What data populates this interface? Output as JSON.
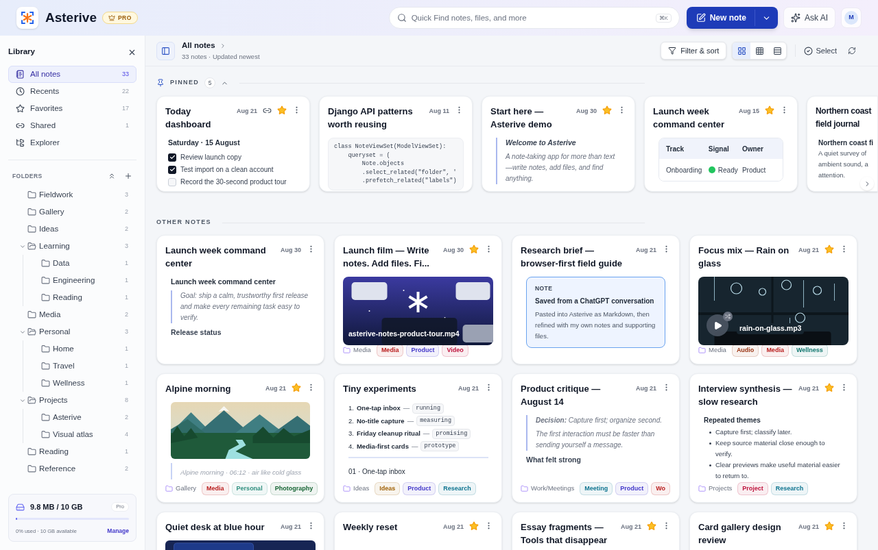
{
  "header": {
    "brand": "Asterive",
    "badge": "PRO",
    "search": {
      "placeholder": "Quick Find notes, files, and more",
      "shortcut": "⌘K"
    },
    "new_note": "New note",
    "ask_ai": "Ask AI",
    "avatar": "M"
  },
  "sidebar": {
    "title": "Library",
    "nav": [
      {
        "kind": "notebook",
        "label": "All notes",
        "count": "33",
        "selected": true
      },
      {
        "kind": "clock",
        "label": "Recents",
        "count": "22",
        "selected": false
      },
      {
        "kind": "star",
        "label": "Favorites",
        "count": "17",
        "selected": false
      },
      {
        "kind": "link",
        "label": "Shared",
        "count": "1",
        "selected": false
      },
      {
        "kind": "tree",
        "label": "Explorer",
        "selected": false
      }
    ],
    "folders_heading": "FOLDERS",
    "folders": [
      {
        "label": "Fieldwork",
        "count": "3",
        "expanded": false
      },
      {
        "label": "Gallery",
        "count": "2",
        "expanded": false
      },
      {
        "label": "Ideas",
        "count": "2",
        "expanded": false
      },
      {
        "label": "Learning",
        "count": "3",
        "expanded": true,
        "children": [
          {
            "label": "Data",
            "count": "1",
            "expanded": false
          },
          {
            "label": "Engineering",
            "count": "1",
            "expanded": false
          },
          {
            "label": "Reading",
            "count": "1",
            "expanded": false
          }
        ]
      },
      {
        "label": "Media",
        "count": "2",
        "expanded": false
      },
      {
        "label": "Personal",
        "count": "3",
        "expanded": true,
        "children": [
          {
            "label": "Home",
            "count": "1",
            "expanded": false
          },
          {
            "label": "Travel",
            "count": "1",
            "expanded": false
          },
          {
            "label": "Wellness",
            "count": "1",
            "expanded": false
          }
        ]
      },
      {
        "label": "Projects",
        "count": "8",
        "expanded": true,
        "children": [
          {
            "label": "Asterive",
            "count": "2",
            "expanded": false
          },
          {
            "label": "Visual atlas",
            "count": "4",
            "expanded": false
          }
        ]
      },
      {
        "label": "Reading",
        "count": "1",
        "expanded": false
      },
      {
        "label": "Reference",
        "count": "2",
        "expanded": false
      }
    ],
    "storage": {
      "usage": "9.8 MB / 10 GB",
      "plan": "Pro",
      "level": 0.01,
      "note": "0% used · 10 GB available",
      "action": "Manage"
    }
  },
  "toolbar": {
    "title": "All notes",
    "subtitle": "33 notes · Updated newest",
    "filter": "Filter & sort",
    "views": [
      {
        "kind": "cards",
        "selected": true
      },
      {
        "kind": "grid",
        "selected": false
      },
      {
        "kind": "rows",
        "selected": false
      }
    ],
    "select": "Select"
  },
  "pinned": {
    "label": "PINNED",
    "count": "5",
    "expanded": true,
    "cards": [
      {
        "title": "Today dashboard",
        "date": "Aug 21",
        "linked": true,
        "starred": true,
        "preview": {
          "kind": "checklist",
          "heading": "Saturday · 15 August",
          "items": [
            {
              "text": "Review launch copy",
              "checked": true
            },
            {
              "text": "Test import on a clean account",
              "checked": true
            },
            {
              "text": "Record the 30-second product tour",
              "checked": false
            }
          ]
        }
      },
      {
        "title": "Django API patterns worth reusing",
        "date": "Aug 11",
        "linked": false,
        "starred": false,
        "preview": {
          "kind": "code",
          "lines": [
            "class NoteViewSet(ModelViewSet):",
            "    queryset = (",
            "        Note.objects",
            "        .select_related(\"folder\", '",
            "        .prefetch_related(\"labels\")"
          ]
        }
      },
      {
        "title": "Start here — Asterive demo",
        "date": "Aug 30",
        "linked": false,
        "starred": true,
        "preview": {
          "kind": "quote",
          "title": "Welcome to Asterive",
          "paragraphs": [
            "A note-taking app for more than text—write notes, add files, and find anything."
          ]
        }
      },
      {
        "title": "Launch week command center",
        "date": "Aug 15",
        "linked": false,
        "starred": true,
        "preview": {
          "kind": "table",
          "columns": [
            "Track",
            "Signal",
            "Owner"
          ],
          "rows": [
            {
              "cells": [
                "Onboarding",
                "Ready",
                "Product"
              ],
              "color": "#22c55e"
            }
          ]
        }
      },
      {
        "title": "Northern coast field journal",
        "linked": false,
        "starred": false,
        "preview": {
          "kind": "text",
          "heading": "Northern coast fi",
          "lines": [
            "A quiet survey of",
            "ambient sound, a",
            "attention."
          ]
        }
      }
    ]
  },
  "other": {
    "label": "OTHER NOTES",
    "cards": [
      {
        "title": "Launch week command center",
        "date": "Aug 30",
        "starred": false,
        "preview": {
          "kind": "quote",
          "heading": "Launch week command center",
          "paragraphs": [
            "Goal: ship a calm, trustworthy first release and make every remaining task easy to verify."
          ],
          "after": "Release status"
        }
      },
      {
        "title": "Launch film — Write notes. Add files. Fi...",
        "date": "Aug 30",
        "starred": true,
        "preview": {
          "kind": "video",
          "file": "asterive-notes-product-tour.mp4"
        },
        "folder": "Media",
        "tags": [
          {
            "label": "Media",
            "color": "#b91c1c"
          },
          {
            "label": "Product",
            "color": "#4338ca"
          },
          {
            "label": "Video",
            "color": "#be123c"
          }
        ]
      },
      {
        "title": "Research brief — browser-first field guide",
        "date": "Aug 21",
        "starred": false,
        "preview": {
          "kind": "callout",
          "label": "NOTE",
          "title": "Saved from a ChatGPT conversation",
          "body": "Pasted into Asterive as Markdown, then refined with my own notes and supporting files."
        }
      },
      {
        "title": "Focus mix — Rain on glass",
        "date": "Aug 21",
        "starred": true,
        "preview": {
          "kind": "audio",
          "file": "rain-on-glass.mp3"
        },
        "folder": "Media",
        "tags": [
          {
            "label": "Audio",
            "color": "#9a3412"
          },
          {
            "label": "Media",
            "color": "#b91c1c"
          },
          {
            "label": "Wellness",
            "color": "#0f766e"
          }
        ]
      },
      {
        "title": "Alpine morning",
        "date": "Aug 21",
        "starred": true,
        "preview": {
          "caption": "Alpine morning · 06:12 · air like cold glass"
        },
        "folder": "Gallery",
        "tags": [
          {
            "label": "Media",
            "color": "#b91c1c"
          },
          {
            "label": "Personal",
            "color": "#2f8f7f"
          },
          {
            "label": "Photography",
            "color": "#166534"
          }
        ]
      },
      {
        "title": "Tiny experiments",
        "date": "Aug 21",
        "starred": false,
        "preview": {
          "kind": "numbered",
          "items": [
            {
              "number": "1.",
              "label": "One-tap inbox",
              "separator": "—",
              "status": "running"
            },
            {
              "number": "2.",
              "label": "No-title capture",
              "separator": "—",
              "status": "measuring"
            },
            {
              "number": "3.",
              "label": "Friday cleanup ritual",
              "separator": "—",
              "status": "promising"
            },
            {
              "number": "4.",
              "label": "Media-first cards",
              "separator": "—",
              "status": "prototype"
            }
          ],
          "footer": "01 · One-tap inbox"
        },
        "folder": "Ideas",
        "tags": [
          {
            "label": "Ideas",
            "color": "#a16207"
          },
          {
            "label": "Product",
            "color": "#4338ca"
          },
          {
            "label": "Research",
            "color": "#0e7490"
          }
        ]
      },
      {
        "title": "Product critique — August 14",
        "date": "Aug 21",
        "starred": false,
        "preview": {
          "kind": "quote",
          "paragraphs": [
            "**Decision:** Capture first; organize second.",
            "The first interaction must be faster than sending yourself a message."
          ],
          "after": "What felt strong"
        },
        "folder": "Work/Meetings",
        "tags": [
          {
            "label": "Meeting",
            "color": "#0e7490"
          },
          {
            "label": "Product",
            "color": "#4338ca"
          },
          {
            "label": "Wo",
            "color": "#b91c1c"
          }
        ]
      },
      {
        "title": "Interview synthesis — slow research",
        "date": "Aug 21",
        "starred": true,
        "preview": {
          "kind": "bullets",
          "heading": "Repeated themes",
          "items": [
            "Capture first; classify later.",
            "Keep source material close enough to verify.",
            "Clear previews make useful material easier to return to."
          ]
        },
        "folder": "Projects",
        "tags": [
          {
            "label": "Project",
            "color": "#be123c"
          },
          {
            "label": "Research",
            "color": "#0e7490"
          }
        ]
      },
      {
        "title": "Quiet desk at blue hour",
        "date": "Aug 21",
        "starred": false
      },
      {
        "title": "Weekly reset",
        "date": "Aug 21",
        "starred": true
      },
      {
        "title": "Essay fragments — Tools that disappear",
        "date": "Aug 21",
        "starred": true
      },
      {
        "title": "Card gallery design review",
        "date": "Aug 21",
        "starred": true
      }
    ]
  }
}
